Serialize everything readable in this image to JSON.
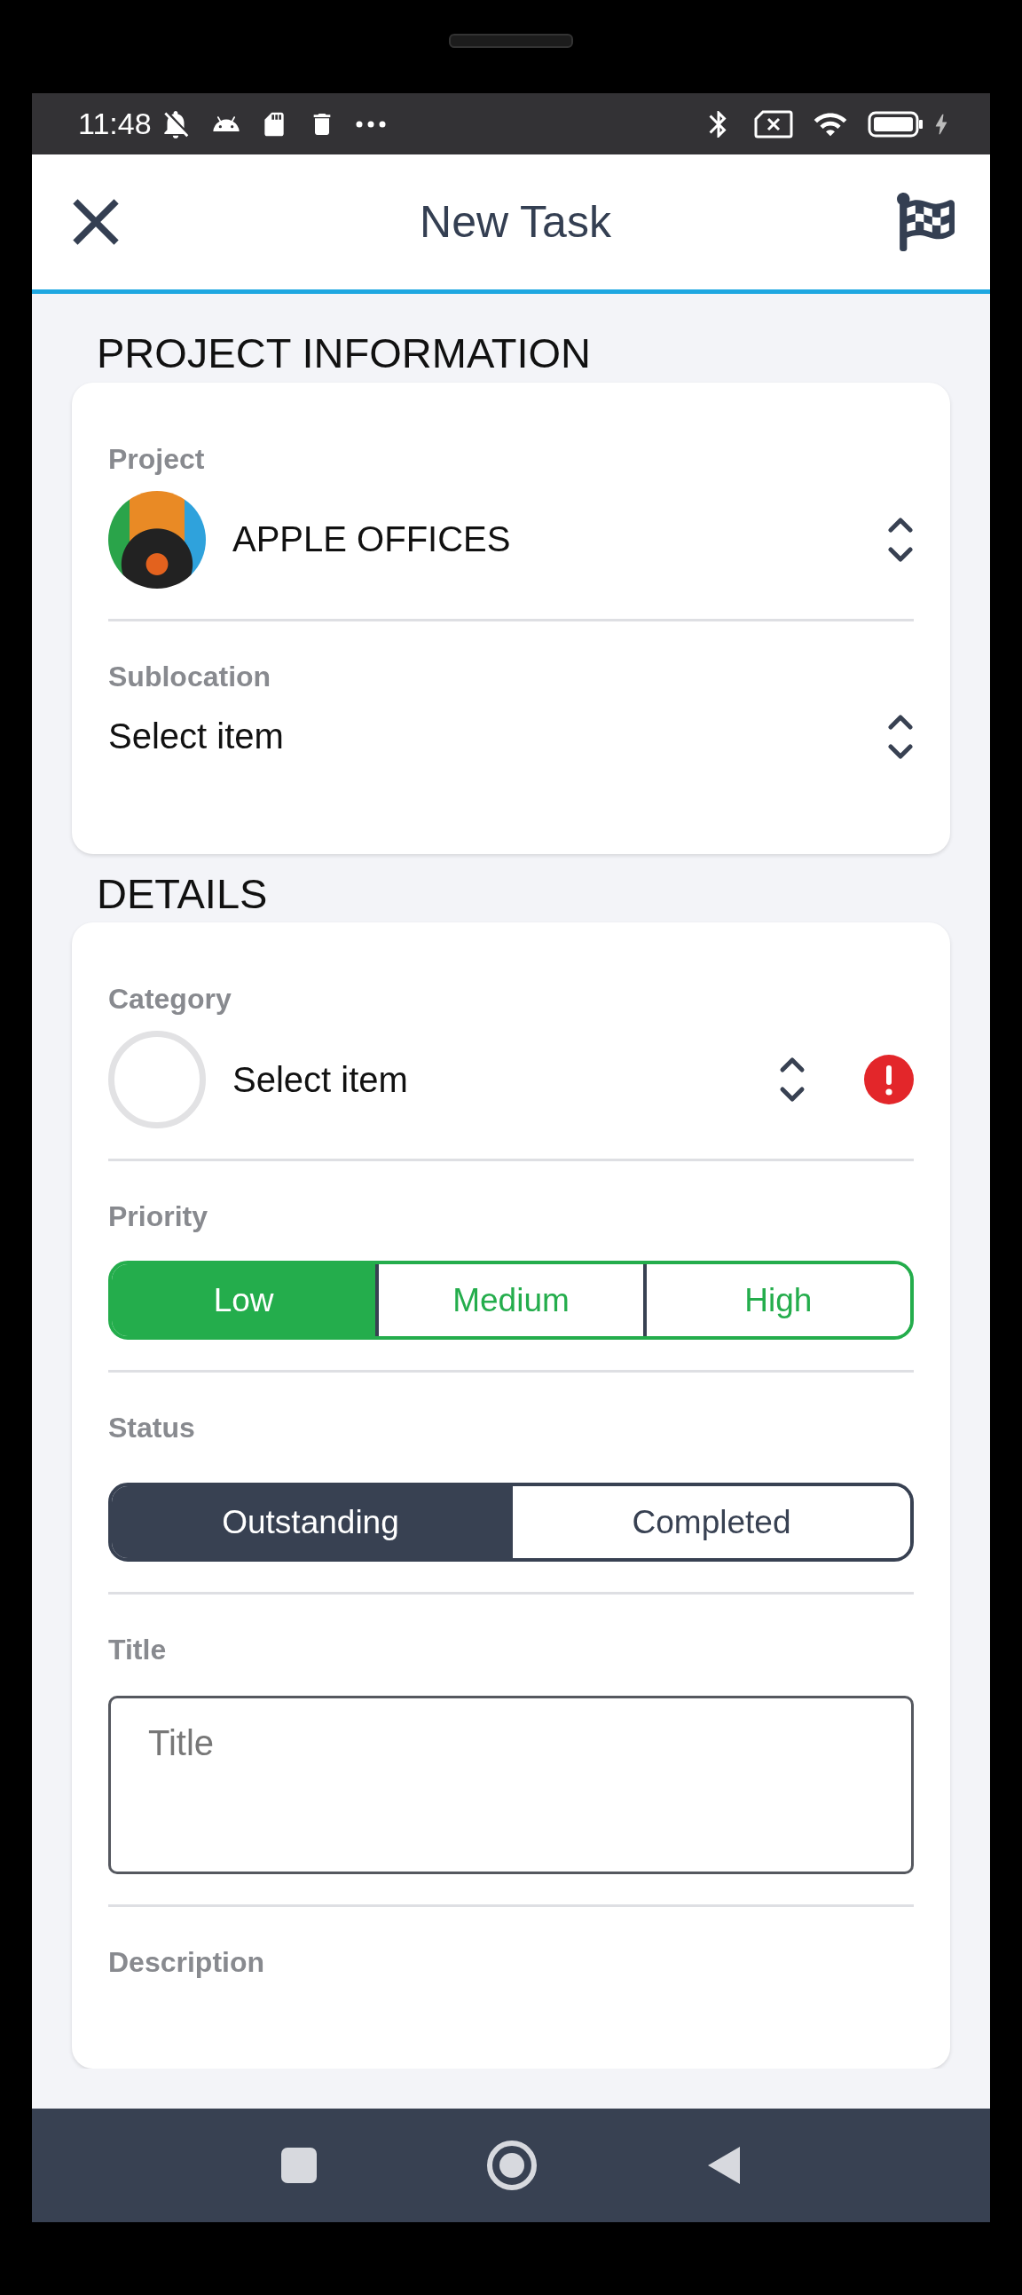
{
  "status_bar": {
    "time": "11:48"
  },
  "header": {
    "title": "New Task"
  },
  "sections": [
    {
      "heading": "PROJECT INFORMATION",
      "fields": [
        {
          "kind": "photoselect",
          "label": "Project",
          "value": "APPLE OFFICES",
          "error": false
        },
        {
          "kind": "select",
          "label": "Sublocation",
          "value": "Select item",
          "error": false
        }
      ]
    },
    {
      "heading": "DETAILS",
      "fields": [
        {
          "kind": "iconselect",
          "label": "Category",
          "value": "Select item",
          "error": true
        },
        {
          "kind": "segmented",
          "label": "Priority",
          "options": [
            {
              "label": "Low",
              "selected": true
            },
            {
              "label": "Medium",
              "selected": false
            },
            {
              "label": "High",
              "selected": false
            }
          ]
        },
        {
          "kind": "segmented",
          "label": "Status",
          "options": [
            {
              "label": "Outstanding",
              "selected": true
            },
            {
              "label": "Completed",
              "selected": false
            }
          ]
        },
        {
          "kind": "textarea",
          "label": "Title",
          "placeholder": "Title"
        },
        {
          "kind": "label",
          "label": "Description"
        }
      ]
    }
  ]
}
